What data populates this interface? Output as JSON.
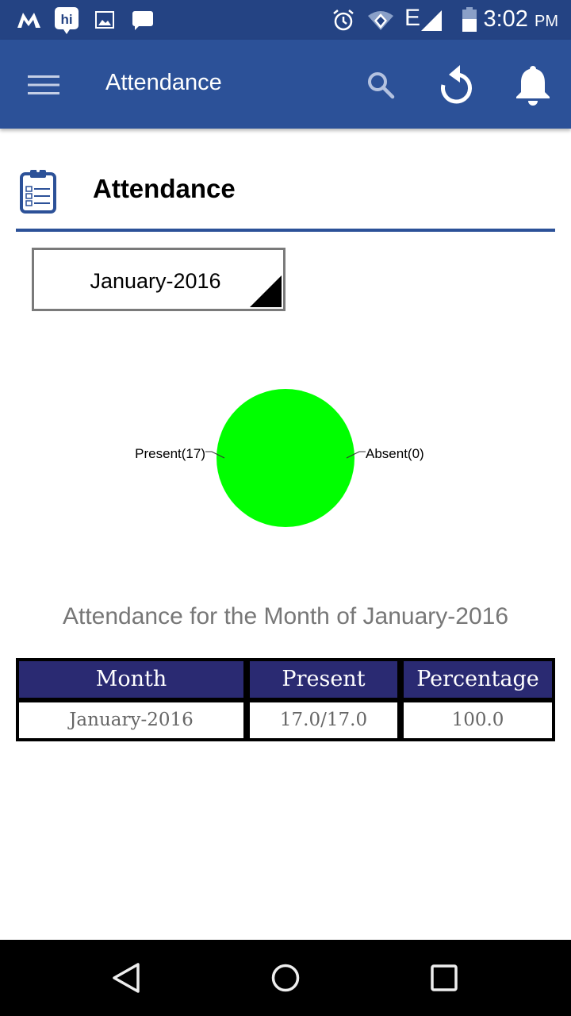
{
  "status_bar": {
    "left_icons": [
      "m-app-icon",
      "hi-app-icon",
      "image-icon",
      "message-icon"
    ],
    "right_icons": [
      "alarm-icon",
      "wifi-icon",
      "network-e-icon",
      "signal-icon",
      "battery-icon"
    ],
    "network_label": "E",
    "time": "3:02",
    "ampm": "PM"
  },
  "app_bar": {
    "title": "Attendance",
    "icons": [
      "menu-icon",
      "search-icon",
      "refresh-icon",
      "bell-icon"
    ]
  },
  "header": {
    "icon": "clipboard-checklist-icon",
    "title": "Attendance"
  },
  "month_selector": {
    "selected": "January-2016"
  },
  "chart_data": {
    "type": "pie",
    "title": "",
    "slices": [
      {
        "label": "Present",
        "value": 17,
        "display": "Present(17)",
        "color": "#00ff00"
      },
      {
        "label": "Absent",
        "value": 0,
        "display": "Absent(0)",
        "color": "#ff0000"
      }
    ]
  },
  "summary_text": "Attendance for the Month of January-2016",
  "table": {
    "headers": [
      "Month",
      "Present",
      "Percentage"
    ],
    "rows": [
      [
        "January-2016",
        "17.0/17.0",
        "100.0"
      ]
    ]
  },
  "colors": {
    "status_bar": "#244383",
    "app_bar": "#2c5198",
    "table_header": "#2a2a72",
    "present": "#00ff00"
  },
  "nav_bar": {
    "buttons": [
      "back-icon",
      "home-icon",
      "recents-icon"
    ]
  }
}
